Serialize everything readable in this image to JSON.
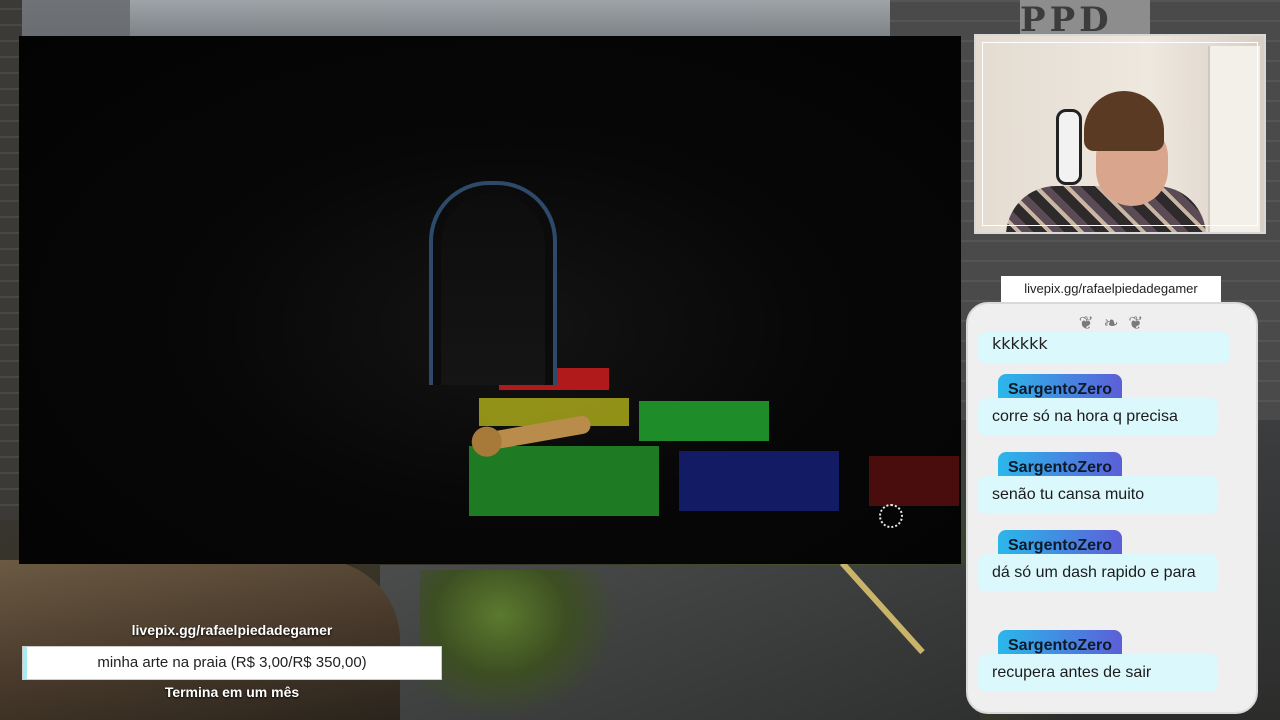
{
  "background": {
    "sign_text": "PPD"
  },
  "webcam": {
    "label": ""
  },
  "chat": {
    "url": "livepix.gg/rafaelpiedadegamer",
    "ornament": "❦ ❧ ❦",
    "partial_message": "kkkkkk",
    "messages": [
      {
        "user": "SargentoZero",
        "text": "corre só na hora q precisa"
      },
      {
        "user": "SargentoZero",
        "text": "senão tu cansa muito"
      },
      {
        "user": "SargentoZero",
        "text": "dá só um dash rapido e para"
      },
      {
        "user": "SargentoZero",
        "text": "recupera antes de sair"
      }
    ]
  },
  "goal": {
    "url": "livepix.gg/rafaelpiedadegamer",
    "title": "minha arte na praia (R$ 3,00/R$ 350,00)",
    "current": 3.0,
    "target": 350.0,
    "progress_fraction": 0.0086,
    "ends": "Termina em um mês"
  },
  "colors": {
    "chat_user_gradient_start": "#2bb7ea",
    "chat_user_gradient_end": "#5c5fd8",
    "chat_bubble": "#dbf8fc",
    "goal_fill": "#a8ebf3"
  }
}
